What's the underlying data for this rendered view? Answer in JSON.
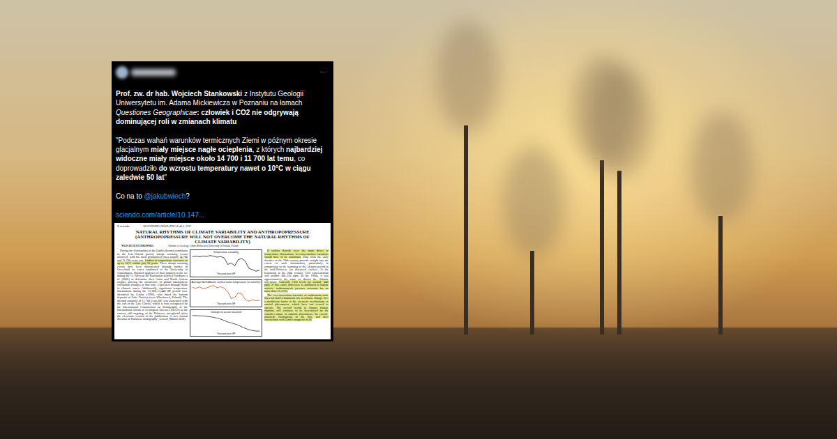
{
  "tweet": {
    "more": "···",
    "paragraphs": [
      [
        {
          "text": "Prof. zw. dr hab. Wojciech Stankowski",
          "style": "bold"
        },
        {
          "text": " z Instytutu Geologii Uniwersytetu im. Adama Mickiewicza w Poznaniu na łamach ",
          "style": "normal"
        },
        {
          "text": "Questiones Geographicae",
          "style": "italic"
        },
        {
          "text": ": człowiek i CO2 nie odgrywają dominującej roli w zmianach klimatu",
          "style": "bold"
        }
      ],
      [
        {
          "text": "\"Podczas wahań warunków termicznych Ziemi w późnym okresie glacjalnym ",
          "style": "normal"
        },
        {
          "text": "miały miejsce nagłe ocieplenia",
          "style": "bold"
        },
        {
          "text": ", z których ",
          "style": "normal"
        },
        {
          "text": "najbardziej widoczne miały miejsce około 14 700 i 11 700 lat temu",
          "style": "bold"
        },
        {
          "text": ", co doprowadziło ",
          "style": "normal"
        },
        {
          "text": "do wzrostu temperatury nawet o 10°C w ciągu zaledwie 50 lat",
          "style": "bold"
        },
        {
          "text": "\"",
          "style": "normal"
        }
      ],
      [
        {
          "text": "Co na to ",
          "style": "normal"
        },
        {
          "text": "@jakubwiech",
          "style": "link"
        },
        {
          "text": "?",
          "style": "normal"
        }
      ]
    ],
    "link": "sciendo.com/article/10.147...",
    "paper": {
      "logo_mark": "S",
      "logo": "sciendo",
      "journal": "QUAESTIONES GEOGRAPHICAE 44(1) • 2025",
      "title": "NATURAL RHYTHMS OF CLIMATE VARIABILITY AND ANTHROPOPRESSURE (ANTHROPOPRESSURE WILL NOT OVERCOME THE NATURAL RHYTHMS OF CLIMATE VARIABILITY)",
      "author": "WOJCIECH STANKOWSKI",
      "affiliation": "Institute of Geology, Adam Mickiewicz University in Poznań, Poland",
      "left_column": [
        [
          {
            "text": "During the fluctuations of the Earth's thermal conditions in the Late-Glacial period, abrupt warming events occurred, with the most pronounced ones around 14,700 and 11,700 years ago, ",
            "highlight": false
          },
          {
            "text": "leading to temperature increases of up to 10°C within just 50 years.",
            "highlight": true
          },
          {
            "text": " These abrupt warming events have been documented through studies of Greenland ice cores conducted at the University of Copenhagen. Detailed analyses of their impacts in the ice during the 11,700-year BP fluctuation allowed Fordham et al. (2005) to determine their Asian and North African origins, proving the occurrence of global atmospheric circulation changes at that time, expressed through shifts in climatic zones. Additionally, significant temperature fluctuations during the 12,380–13,440 BP period were identified by Goslar (1996), who dated the bottom deposits of Lake Gościąż (near Włocławek, Poland). The thermal anomaly of 11,700 years BP, was associated with the end of the Late Glacial, which is now recognized by the International Commission on Stratigraphy of the International Union of Geological Sciences (IUGS) as the current, still ongoing, of the Holocene interglacial (after the electronic version of the publication 'A new formal division of Holocene stratigraphy', Lowell, Martin 2018).",
            "highlight": false
          }
        ]
      ],
      "charts": [
        {
          "title": "Temperature variability",
          "x_label": "Thousand years BP",
          "series": [
            {
              "values": [
                -0.5,
                -0.3,
                -0.6,
                -0.2,
                -0.4,
                0.0,
                -0.3,
                -0.8,
                -0.5,
                -1.2,
                -4.5,
                -3.8,
                -5.2,
                -2.1,
                -1.5,
                -3.0,
                -6.5,
                -7.2,
                -8.0,
                -7.5
              ],
              "color": "#222222"
            }
          ]
        },
        {
          "title": "Average North Atlantic surface water temperature (in summer)",
          "x_label": "Thousand years BP",
          "series": [
            {
              "values": [
                15.2,
                14.8,
                15.5,
                14.6,
                15.0,
                15.8,
                16.2,
                15.1,
                15.6,
                14.9,
                13.0,
                9.5,
                10.2,
                12.5,
                11.8,
                9.0,
                8.2,
                8.8,
                8.5,
                8.6
              ],
              "color": "#d9541e"
            }
          ]
        },
        {
          "title": "Changes in ocean sea level",
          "x_label": "Thousand years BP",
          "series": [
            {
              "values": [
                0,
                -1,
                -2,
                -4,
                -6,
                -10,
                -14,
                -20,
                -28,
                -38,
                -50,
                -58,
                -65,
                -75,
                -88,
                -100,
                -110,
                -116,
                -120,
                -121
              ],
              "color": "#333333"
            }
          ]
        }
      ],
      "right_column": [
        [
          {
            "text": "If carbon dioxide were the main driver of temperature fluctuations, its concentration variations would have to be enormous.",
            "highlight": true
          },
          {
            "text": " Data from the early decades of the 20th century provide insight into the extent of such fluctuations, particularly in comparison to the warming of the Atlantic period in the mid-Holocene (as discussed earlier). At the beginning of the 20th century, CO2 concentration was around 300–310 ppm. In the 1960s, it was approximately the same as during the Atlantic maximum. ",
            "highlight": false
          },
          {
            "text": "Currently, CO2 levels are around ~400 ppm. If this entire difference is attributed to human activity, anthropogenic pressure accounts for no more than 15–35%.",
            "highlight": true
          }
        ],
        [
          {
            "text": "The ever-increasing intensity of anthropopressure does not hold a dominant role in climate change. It is a modifying factor in the energetic mechanisms of natural phenomena, which have not ceased to operate. The overall trends in climate change rhythms will continue to be determined by the complex nature of galactic phenomena, the energy-magnetic fluctuations of the Sun, and their interactions with Earth's magnetic field.",
            "highlight": true
          }
        ]
      ]
    }
  }
}
